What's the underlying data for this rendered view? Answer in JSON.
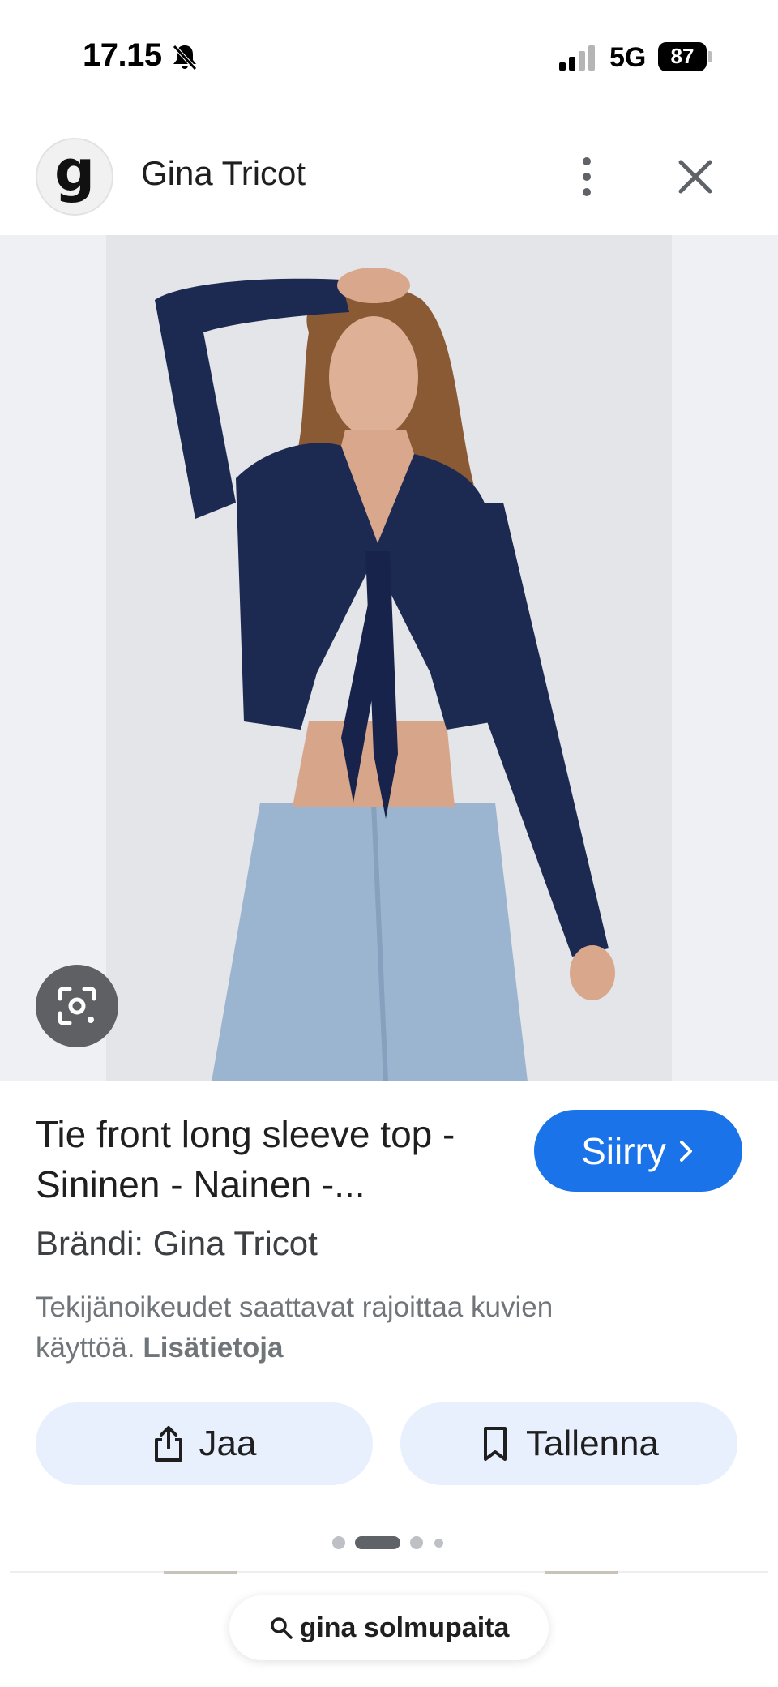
{
  "status_bar": {
    "time": "17.15",
    "network": "5G",
    "battery": "87"
  },
  "header": {
    "avatar_letter": "g",
    "site_name": "Gina Tricot"
  },
  "result": {
    "title": "Tie front long sleeve top - Sininen - Nainen -...",
    "visit_label": "Siirry",
    "brand": "Brändi: Gina Tricot",
    "copyright_text": "Tekijänoikeudet saattavat rajoittaa kuvien käyttöä.",
    "learn_more": "Lisätietoja"
  },
  "actions": {
    "share_label": "Jaa",
    "save_label": "Tallenna"
  },
  "pager": {
    "count": 4,
    "active_index": 1
  },
  "search_chip": {
    "query": "gina solmupaita"
  },
  "colors": {
    "accent": "#1a73e8",
    "action_bg": "#e8f0fe",
    "top_color": "#1c2a52",
    "jeans_color": "#9bb4cf"
  },
  "icons": [
    "bell-muted-icon",
    "signal-icon",
    "battery-icon",
    "more-vert-icon",
    "close-icon",
    "lens-icon",
    "chevron-right-icon",
    "share-icon",
    "bookmark-icon",
    "search-icon"
  ]
}
